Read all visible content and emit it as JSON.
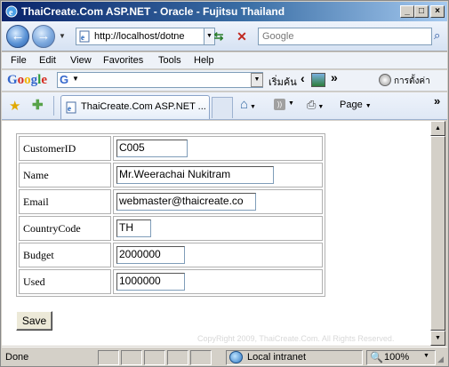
{
  "window": {
    "title": "ThaiCreate.Com ASP.NET - Oracle - Fujitsu Thailand",
    "min_glyph": "_",
    "max_glyph": "□",
    "close_glyph": "×"
  },
  "nav": {
    "back_glyph": "←",
    "forward_glyph": "→",
    "address": "http://localhost/dotne",
    "refresh_glyph": "⇆",
    "stop_glyph": "✕",
    "search_placeholder": "Google",
    "search_glyph": "⌕"
  },
  "menu": {
    "items": [
      "File",
      "Edit",
      "View",
      "Favorites",
      "Tools",
      "Help"
    ]
  },
  "google_toolbar": {
    "logo": "Google",
    "search_button": "เริ่มค้น",
    "more": "»",
    "settings": "การตั้งค่า"
  },
  "tabbar": {
    "tab_title": "ThaiCreate.Com ASP.NET ...",
    "page_menu": "Page",
    "more": "»"
  },
  "form": {
    "rows": [
      {
        "label": "CustomerID",
        "value": "C005"
      },
      {
        "label": "Name",
        "value": "Mr.Weerachai Nukitram"
      },
      {
        "label": "Email",
        "value": "webmaster@thaicreate.co"
      },
      {
        "label": "CountryCode",
        "value": "TH"
      },
      {
        "label": "Budget",
        "value": "2000000"
      },
      {
        "label": "Used",
        "value": "1000000"
      }
    ],
    "save_label": "Save"
  },
  "watermark": "CopyRight 2009, ThaiCreate.Com. All Rights Reserved.",
  "status": {
    "text": "Done",
    "zone": "Local intranet",
    "zoom": "100%"
  }
}
